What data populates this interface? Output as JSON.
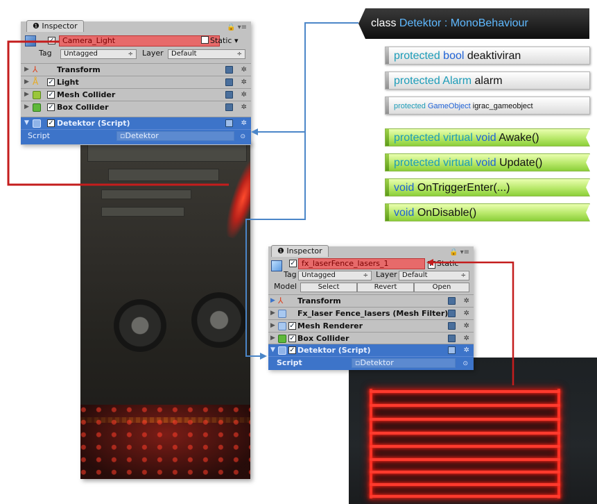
{
  "inspector1": {
    "tab_label": "Inspector",
    "object_name": "Camera_Light",
    "static_label": "Static",
    "tag_label": "Tag",
    "tag_value": "Untagged",
    "layer_label": "Layer",
    "layer_value": "Default",
    "components": [
      {
        "label": "Transform",
        "icon": "transform-icon"
      },
      {
        "label": "Light",
        "icon": "light-icon"
      },
      {
        "label": "Mesh Collider",
        "icon": "mesh-collider-icon"
      },
      {
        "label": "Box Collider",
        "icon": "box-collider-icon"
      },
      {
        "label": "Detektor (Script)",
        "icon": "script-icon"
      }
    ],
    "script_label": "Script",
    "script_value": "Detektor"
  },
  "inspector2": {
    "tab_label": "Inspector",
    "object_name": "fx_laserFence_lasers_1",
    "static_label": "Static",
    "tag_label": "Tag",
    "tag_value": "Untagged",
    "layer_label": "Layer",
    "layer_value": "Default",
    "model_label": "Model",
    "select_label": "Select",
    "revert_label": "Revert",
    "open_label": "Open",
    "components": [
      {
        "label": "Transform",
        "icon": "transform-icon"
      },
      {
        "label": "Fx_laser Fence_lasers (Mesh Filter)",
        "icon": "mesh-filter-icon"
      },
      {
        "label": "Mesh Renderer",
        "icon": "mesh-renderer-icon"
      },
      {
        "label": "Box Collider",
        "icon": "box-collider-icon"
      },
      {
        "label": "Detektor (Script)",
        "icon": "script-icon"
      }
    ],
    "script_label": "Script",
    "script_value": "Detektor"
  },
  "class_diagram": {
    "header_keyword": "class",
    "header_name": "Detektor : MonoBehaviour",
    "fields": [
      {
        "modifier": "protected",
        "type": "bool",
        "name": "deaktiviran"
      },
      {
        "modifier": "protected",
        "type": "Alarm",
        "name": "alarm"
      },
      {
        "modifier": "protected",
        "type": "GameObject",
        "name": "igrac_gameobject"
      }
    ],
    "methods": [
      {
        "modifier": "protected virtual",
        "type": "void",
        "name": "Awake()"
      },
      {
        "modifier": "protected virtual",
        "type": "void",
        "name": "Update()"
      },
      {
        "modifier": "",
        "type": "void",
        "name": "OnTriggerEnter(...)"
      },
      {
        "modifier": "",
        "type": "void",
        "name": "OnDisable()"
      }
    ]
  },
  "colors": {
    "highlight_red": "#e76a6a",
    "selection_blue": "#3d74c9",
    "connector_red": "#c41d1d",
    "connector_blue": "#4b86c8",
    "laser": "#ff3b2e",
    "method_green": "#b8e86a"
  }
}
